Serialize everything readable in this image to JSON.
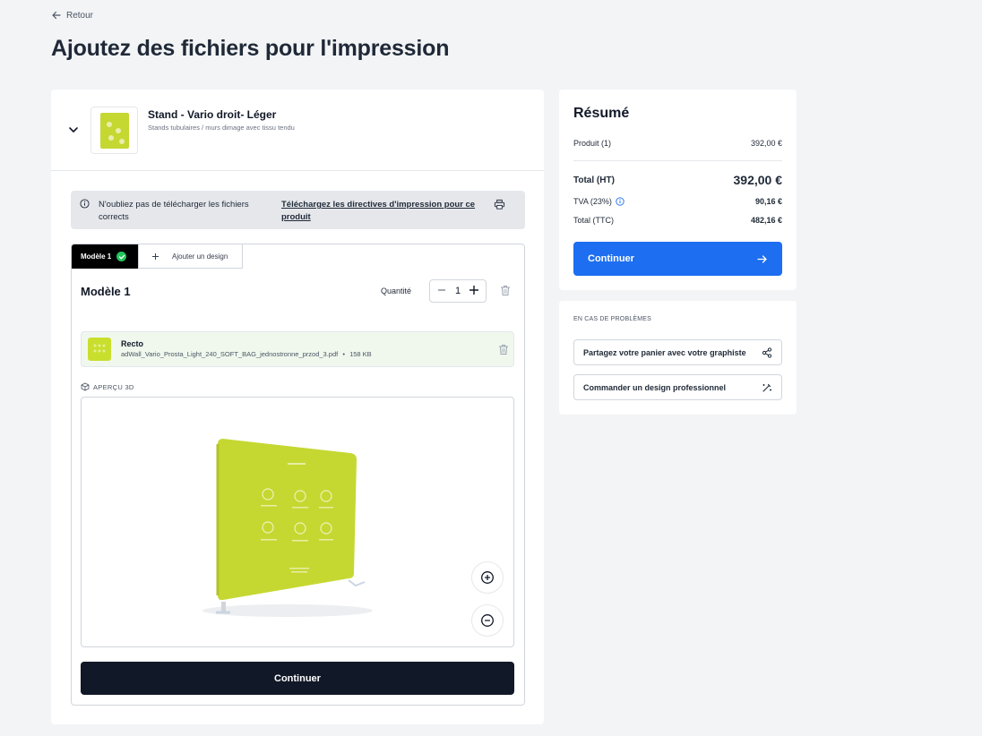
{
  "nav": {
    "back_label": "Retour"
  },
  "page": {
    "title": "Ajoutez des fichiers pour l'impression"
  },
  "product": {
    "name": "Stand - Vario droit- Léger",
    "subtitle": "Stands tubulaires / murs dimage avec tissu tendu"
  },
  "notice": {
    "text": "N'oubliez pas de télécharger les fichiers corrects",
    "link": "Téléchargez les directives d'impression pour ce produit"
  },
  "design": {
    "tab_active": "Modèle 1",
    "tab_add": "Ajouter un design",
    "title": "Modèle 1",
    "quantity_label": "Quantité",
    "quantity": "1",
    "file": {
      "side": "Recto",
      "name": "adWall_Vario_Prosta_Light_240_SOFT_BAG_jednostronne_przod_3.pdf",
      "sep": "•",
      "size": "158 KB"
    },
    "preview_label": "APERÇU 3D",
    "continue_label": "Continuer"
  },
  "summary": {
    "title": "Résumé",
    "product_label": "Produit (1)",
    "product_value": "392,00 €",
    "total_ht_label": "Total (HT)",
    "total_ht_value": "392,00 €",
    "tva_label": "TVA (23%)",
    "tva_value": "90,16 €",
    "total_ttc_label": "Total (TTC)",
    "total_ttc_value": "482,16 €",
    "continue_label": "Continuer"
  },
  "help": {
    "title": "EN CAS DE PROBLÈMES",
    "share_label": "Partagez votre panier avec votre graphiste",
    "order_label": "Commander un design professionnel"
  },
  "colors": {
    "accent": "#1d6ef0",
    "dark_button": "#111827",
    "success": "#22c55e",
    "product_lime": "#c5d832"
  }
}
